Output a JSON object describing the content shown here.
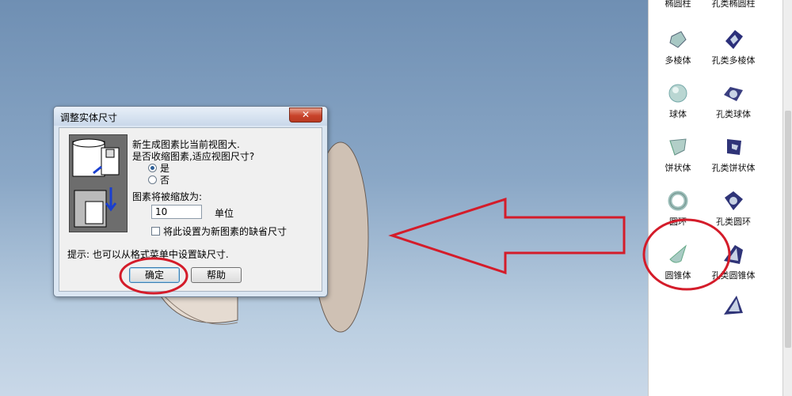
{
  "dialog": {
    "title": "调整实体尺寸",
    "close_label": "✕",
    "message_line1": "新生成图素比当前视图大.",
    "message_line2": "是否收缩图素,适应视图尺寸?",
    "option_yes": "是",
    "option_no": "否",
    "selected_option": "是",
    "scale_label": "图素将被缩放为:",
    "scale_value": "10",
    "unit_label": "单位",
    "default_checkbox_label": "将此设置为新图素的缺省尺寸",
    "default_checkbox_checked": false,
    "hint": "提示: 也可以从格式菜单中设置缺尺寸.",
    "ok_label": "确定",
    "help_label": "帮助"
  },
  "palette": {
    "items": [
      {
        "label": "椭圆柱",
        "icon": "elliptic-cylinder-icon"
      },
      {
        "label": "孔类椭圆柱",
        "icon": "hole-elliptic-cylinder-icon"
      },
      {
        "label": "多棱体",
        "icon": "polyprism-icon"
      },
      {
        "label": "孔类多棱体",
        "icon": "hole-polyprism-icon"
      },
      {
        "label": "球体",
        "icon": "sphere-icon"
      },
      {
        "label": "孔类球体",
        "icon": "hole-sphere-icon"
      },
      {
        "label": "饼状体",
        "icon": "pie-solid-icon"
      },
      {
        "label": "孔类饼状体",
        "icon": "hole-pie-solid-icon"
      },
      {
        "label": "圆环",
        "icon": "torus-icon"
      },
      {
        "label": "孔类圆环",
        "icon": "hole-torus-icon"
      },
      {
        "label": "圆锥体",
        "icon": "cone-icon"
      },
      {
        "label": "孔类圆锥体",
        "icon": "hole-cone-icon"
      },
      {
        "label": "",
        "icon": "hole-pyramid-icon"
      }
    ]
  },
  "colors": {
    "annotation_red": "#d41c2a",
    "viewport_top": "#6f8fb3",
    "viewport_bottom": "#c9d8e8"
  }
}
